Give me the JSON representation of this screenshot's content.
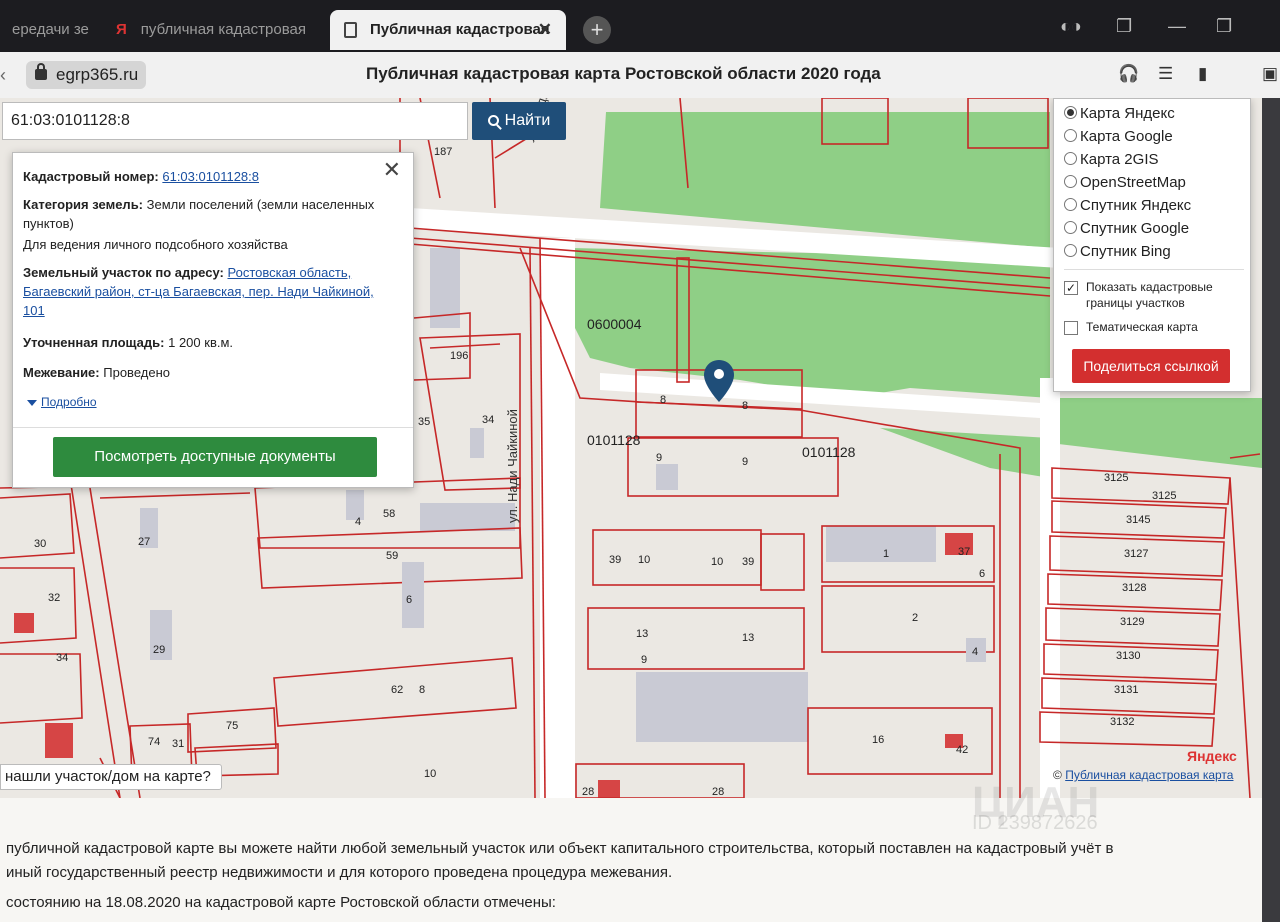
{
  "browser": {
    "tabs": [
      {
        "label": "ередачи зе"
      },
      {
        "label": "публичная кадастровая",
        "prefix": "Я"
      },
      {
        "label": "Публичная кадастровая",
        "close": "✕"
      }
    ],
    "new_tab": "+",
    "domain": "egrp365.ru",
    "page_title": "Публичная кадастровая карта Ростовской области 2020 года"
  },
  "search": {
    "value": "61:03:0101128:8",
    "button": "Найти"
  },
  "info_popup": {
    "close": "✕",
    "cadastral_label": "Кадастровый номер:",
    "cadastral_value": "61:03:0101128:8",
    "category_label": "Категория земель:",
    "category_value": "Земли поселений (земли населенных пунктов)",
    "usage": "Для ведения личного подсобного хозяйства",
    "address_label": "Земельный участок по адресу:",
    "address_value": "Ростовская область, Багаевский район, ст-ца Багаевская, пер. Нади Чайкиной, 101",
    "area_label": "Уточненная площадь:",
    "area_value": "1 200 кв.м.",
    "survey_label": "Межевание:",
    "survey_value": "Проведено",
    "more": "Подробно",
    "docs_button": "Посмотреть доступные документы"
  },
  "layers": {
    "options": [
      "Карта Яндекс",
      "Карта Google",
      "Карта 2GIS",
      "OpenStreetMap",
      "Спутник Яндекс",
      "Спутник Google",
      "Спутник Bing"
    ],
    "selected": "Карта Яндекс",
    "show_borders": "Показать кадастровые границы участков",
    "show_borders_checked": true,
    "thematic": "Тематическая карта",
    "thematic_checked": false,
    "share_button": "Поделиться ссылкой"
  },
  "map": {
    "street_label": "ул. Нади Чайкиной",
    "quarter_labels": [
      "0600004",
      "0101128",
      "0101128"
    ],
    "parcel_numbers": [
      "187",
      "196",
      "35",
      "34",
      "8",
      "8",
      "9",
      "9",
      "30",
      "27",
      "4",
      "58",
      "59",
      "32",
      "6",
      "39",
      "10",
      "10",
      "39",
      "1",
      "37",
      "6",
      "2",
      "4",
      "13",
      "13",
      "9",
      "29",
      "34",
      "62",
      "8",
      "75",
      "74",
      "31",
      "16",
      "42",
      "10",
      "28",
      "28",
      "3125",
      "3125",
      "3145",
      "3127",
      "3128",
      "3129",
      "3130",
      "3131",
      "3132"
    ],
    "not_found": "нашли участок/дом на карте?",
    "copyright_prefix": "©",
    "copyright_link": "Публичная кадастровая карта",
    "provider": "Яндекс"
  },
  "page_text": {
    "line1": "публичной кадастровой карте вы можете найти любой земельный участок или объект капитального строительства, который поставлен на кадастровый учёт в",
    "line2": "иный государственный реестр недвижимости и для которого проведена процедура межевания.",
    "line3": "состоянию на 18.08.2020 на кадастровой карте Ростовской области отмечены:"
  },
  "watermark": {
    "brand": "ЦИАН",
    "id": "ID 239872626"
  },
  "colors": {
    "parcel_border": "#c62828",
    "green_zone": "#8fcf86",
    "search_button": "#1f4e79",
    "docs_button": "#2e8b3e",
    "share_button": "#d32f2f",
    "marker": "#1f4e79"
  }
}
